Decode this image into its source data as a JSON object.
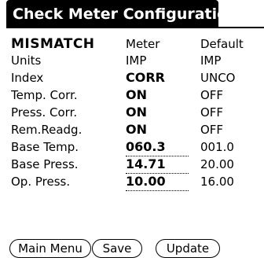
{
  "window": {
    "title": "Check Meter Configuration"
  },
  "table": {
    "header": {
      "label": "MISMATCH",
      "meter": "Meter",
      "default": "Default"
    },
    "rows": [
      {
        "label": "Units",
        "meter": "IMP",
        "default": "IMP",
        "meter_bold": false,
        "editable": false
      },
      {
        "label": "Index",
        "meter": "CORR",
        "default": "UNCO",
        "meter_bold": true,
        "editable": false
      },
      {
        "label": "Temp. Corr.",
        "meter": "ON",
        "default": "OFF",
        "meter_bold": true,
        "editable": false
      },
      {
        "label": "Press. Corr.",
        "meter": "ON",
        "default": "OFF",
        "meter_bold": true,
        "editable": false
      },
      {
        "label": "Rem.Readg.",
        "meter": "ON",
        "default": "OFF",
        "meter_bold": true,
        "editable": false
      },
      {
        "label": "Base Temp.",
        "meter": "060.3",
        "default": "001.0",
        "meter_bold": true,
        "editable": true
      },
      {
        "label": "Base Press.",
        "meter": "14.71",
        "default": "20.00",
        "meter_bold": true,
        "editable": true
      },
      {
        "label": "Op. Press.",
        "meter": "10.00",
        "default": "16.00",
        "meter_bold": true,
        "editable": true
      }
    ]
  },
  "buttons": {
    "main_menu": "Main Menu",
    "save": "Save",
    "update": "Update"
  }
}
